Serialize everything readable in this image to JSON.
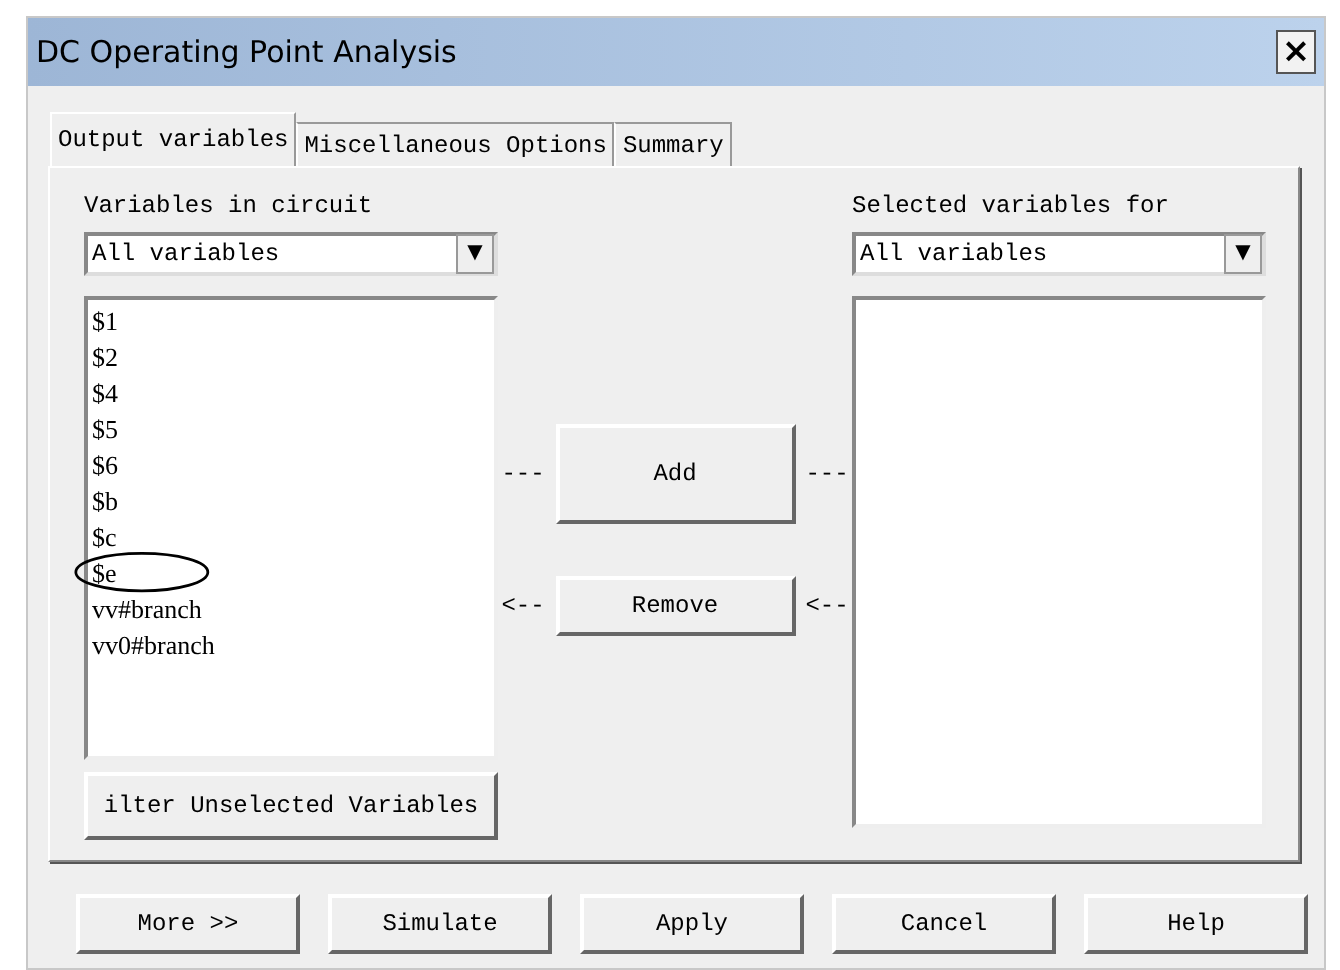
{
  "window": {
    "title": "DC Operating Point Analysis",
    "close": "×"
  },
  "tabs": [
    {
      "label": "Output variables",
      "selected": true
    },
    {
      "label": "Miscellaneous Options",
      "selected": false
    },
    {
      "label": "Summary",
      "selected": false
    }
  ],
  "left": {
    "label": "Variables in circuit",
    "dropdown": "All variables",
    "arrow": "▼",
    "items": [
      "$1",
      "$2",
      "$4",
      "$5",
      "$6",
      "$b",
      "$c",
      "$e",
      "vv#branch",
      "vv0#branch"
    ],
    "filter_button": "ilter Unselected Variables"
  },
  "middle": {
    "add": "Add",
    "remove": "Remove",
    "add_left": "---",
    "add_right": "---",
    "remove_left": "<--",
    "remove_right": "<--"
  },
  "right": {
    "label": "Selected variables for",
    "dropdown": "All variables",
    "arrow": "▼"
  },
  "buttons": [
    "More >>",
    "Simulate",
    "Apply",
    "Cancel",
    "Help"
  ]
}
